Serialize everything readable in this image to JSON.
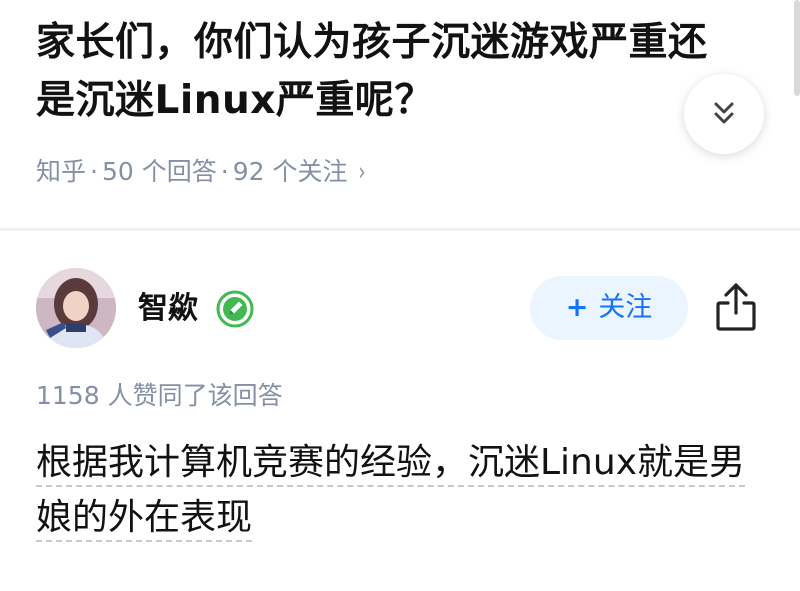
{
  "question": {
    "title": "家长们，你们认为孩子沉迷游戏严重还是沉迷Linux严重呢？",
    "source": "知乎",
    "separator": "·",
    "answers": "50 个回答",
    "followers": "92 个关注",
    "chevron": "›"
  },
  "answer": {
    "author_name": "智歘",
    "follow_label": "关注",
    "follow_plus": "+",
    "likes": "1158 人赞同了该回答",
    "content": "根据我计算机竞赛的经验，沉迷Linux就是男娘的外在表现"
  },
  "icons": {
    "expand": "double-chevron-down-icon",
    "share": "share-icon",
    "badge": "pencil-badge-icon"
  },
  "colors": {
    "title_text": "#121212",
    "meta_text": "#8590a6",
    "follow_bg": "#ebf5ff",
    "follow_text": "#1772f6",
    "badge_green": "#3fb950"
  }
}
